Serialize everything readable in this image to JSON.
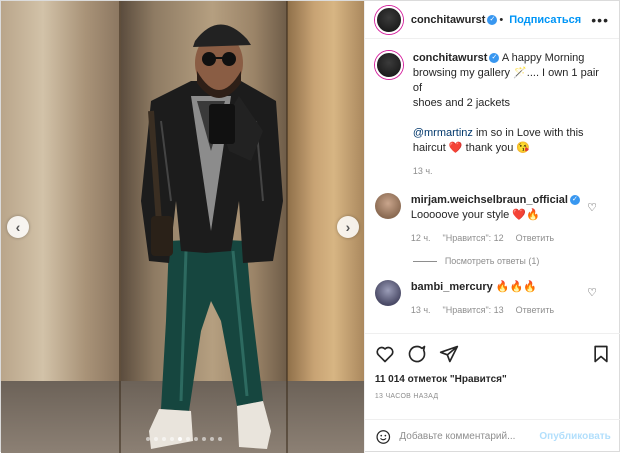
{
  "post": {
    "username": "conchitawurst",
    "follow_label": "Подписаться",
    "more_label": "•••",
    "caption_lines": [
      "A happy Morning",
      "browsing my gallery 🪄.... I own 1 pair of",
      "shoes and 2 jackets"
    ],
    "mention": "@mrmartinz",
    "caption2_lines": [
      " im so in Love with this",
      "haircut ❤️ thank you 😘"
    ],
    "caption_time": "13 ч."
  },
  "comments": [
    {
      "username": "mirjam.weichselbraun_official",
      "text": "Looooove your style ❤️🔥",
      "time": "12 ч.",
      "likes": "\"Нравится\": 12",
      "reply": "Ответить",
      "view_replies": "Посмотреть ответы (1)"
    },
    {
      "username": "bambi_mercury",
      "text": "🔥🔥🔥",
      "time": "13 ч.",
      "likes": "\"Нравится\": 13",
      "reply": "Ответить"
    }
  ],
  "actions": {
    "likes_text": "11 014 отметок \"Нравится\"",
    "time_ago": "13 ЧАСОВ НАЗАД"
  },
  "composer": {
    "placeholder": "Добавьте комментарий...",
    "publish_label": "Опубликовать"
  },
  "icons": [
    "heart-icon",
    "comment-icon",
    "share-icon",
    "bookmark-icon",
    "emoji-icon",
    "verified-icon",
    "chevron-left-icon",
    "chevron-right-icon"
  ],
  "colors": {
    "accent": "#0095f6",
    "text": "#262626",
    "muted": "#8e8e8e",
    "verified": "#3897f0"
  }
}
